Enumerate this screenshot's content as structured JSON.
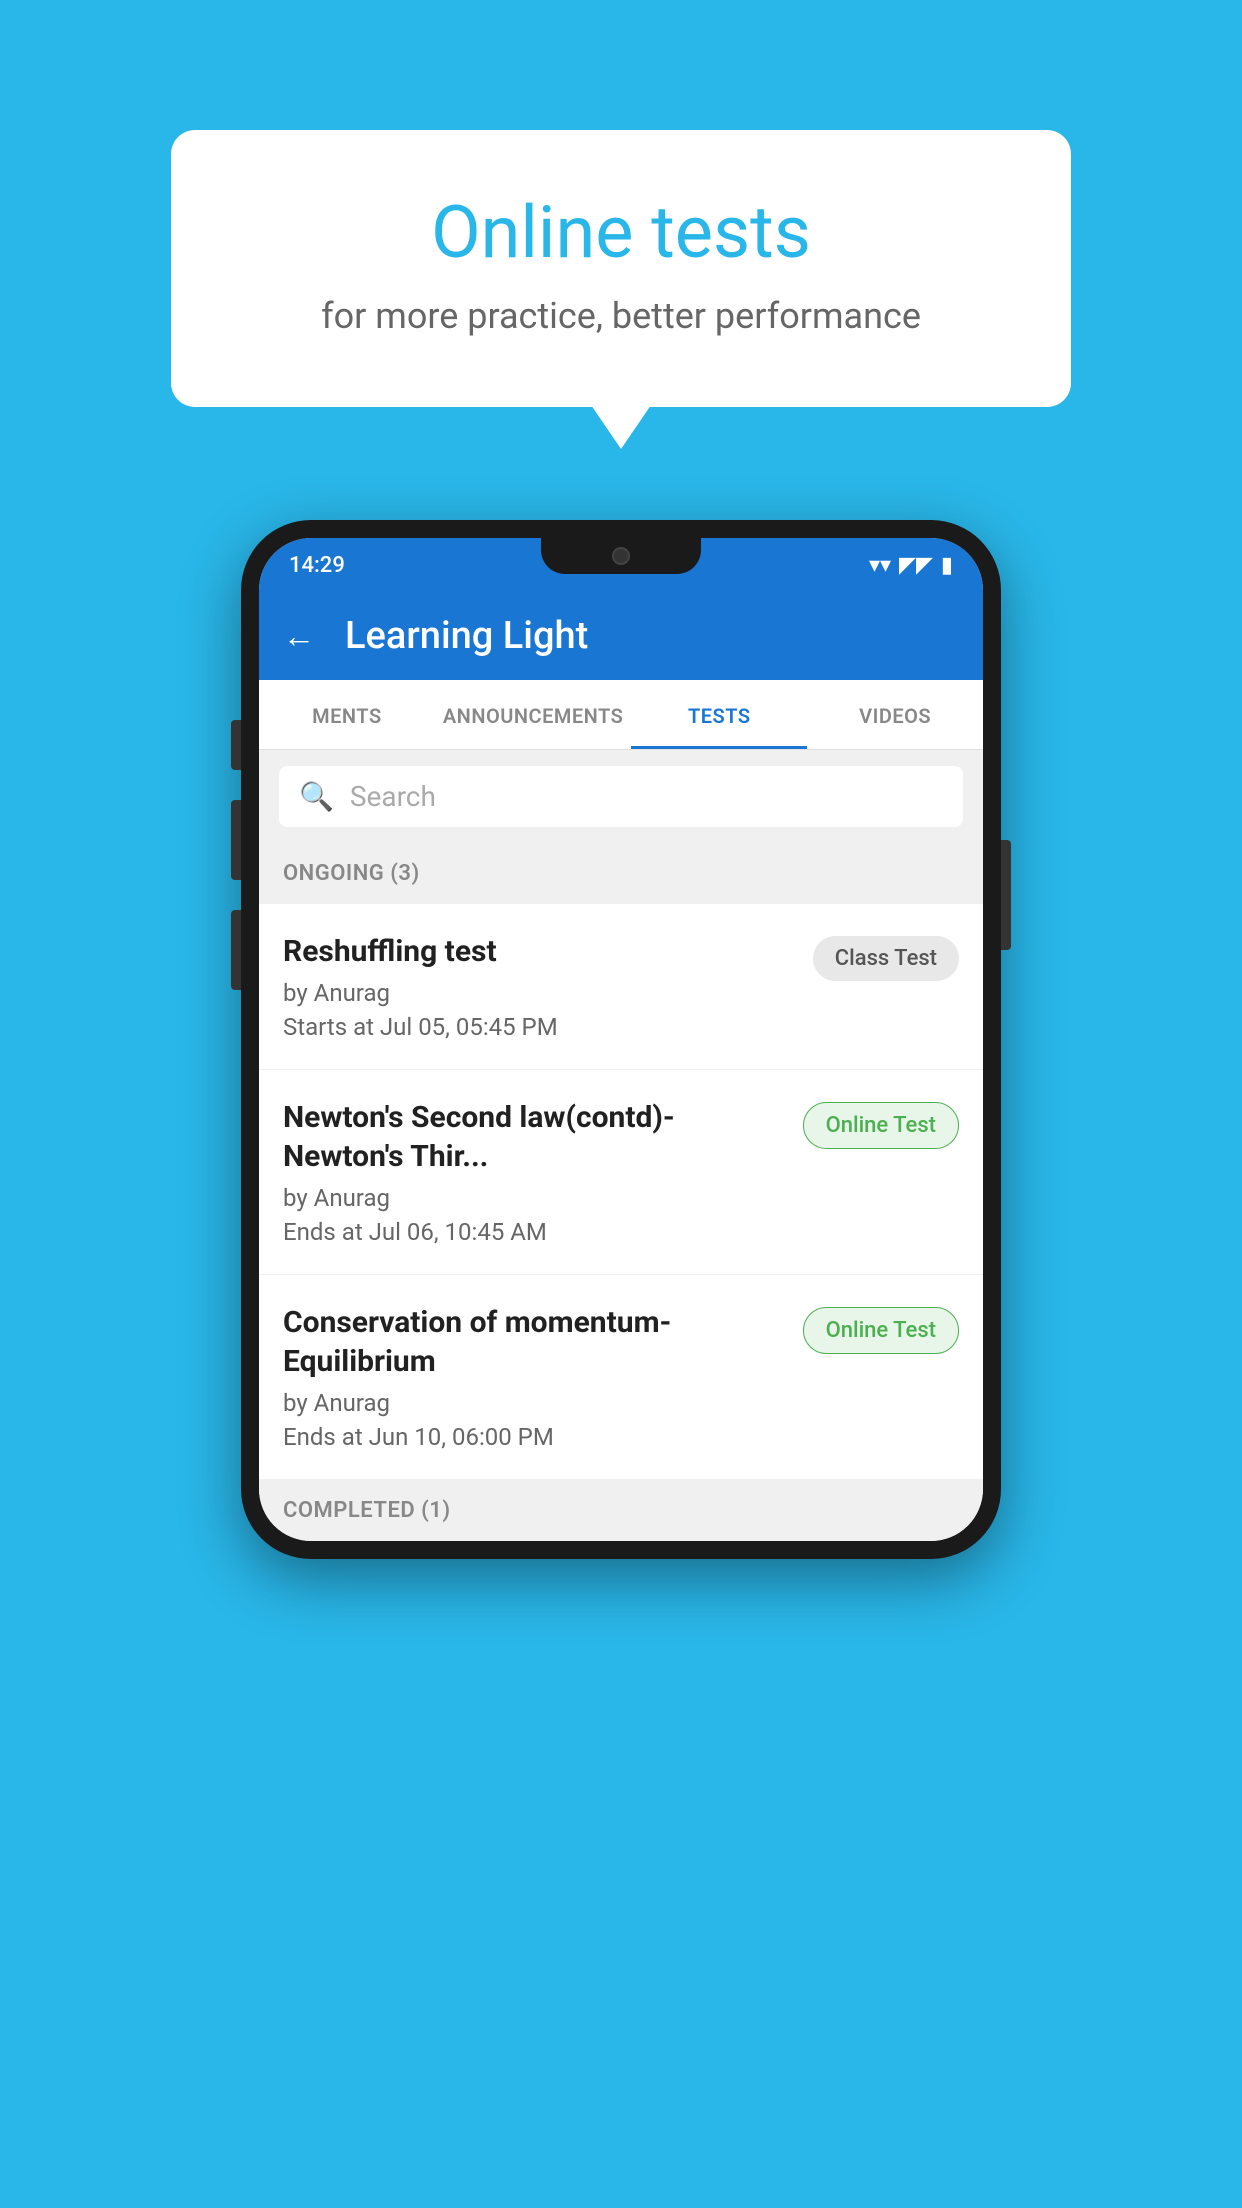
{
  "background": {
    "color": "#29B6E8"
  },
  "speech_bubble": {
    "title": "Online tests",
    "subtitle": "for more practice, better performance"
  },
  "phone": {
    "status_bar": {
      "time": "14:29",
      "wifi": "▼",
      "signal": "▲",
      "battery": "▮"
    },
    "app_bar": {
      "back_label": "←",
      "title": "Learning Light"
    },
    "tabs": [
      {
        "label": "MENTS",
        "active": false
      },
      {
        "label": "ANNOUNCEMENTS",
        "active": false
      },
      {
        "label": "TESTS",
        "active": true
      },
      {
        "label": "VIDEOS",
        "active": false
      }
    ],
    "search": {
      "placeholder": "Search"
    },
    "ongoing_section": {
      "header": "ONGOING (3)"
    },
    "tests": [
      {
        "name": "Reshuffling test",
        "author": "by Anurag",
        "date": "Starts at  Jul 05, 05:45 PM",
        "badge": "Class Test",
        "badge_type": "class"
      },
      {
        "name": "Newton's Second law(contd)-Newton's Thir...",
        "author": "by Anurag",
        "date": "Ends at  Jul 06, 10:45 AM",
        "badge": "Online Test",
        "badge_type": "online"
      },
      {
        "name": "Conservation of momentum-Equilibrium",
        "author": "by Anurag",
        "date": "Ends at  Jun 10, 06:00 PM",
        "badge": "Online Test",
        "badge_type": "online"
      }
    ],
    "completed_section": {
      "header": "COMPLETED (1)"
    }
  }
}
